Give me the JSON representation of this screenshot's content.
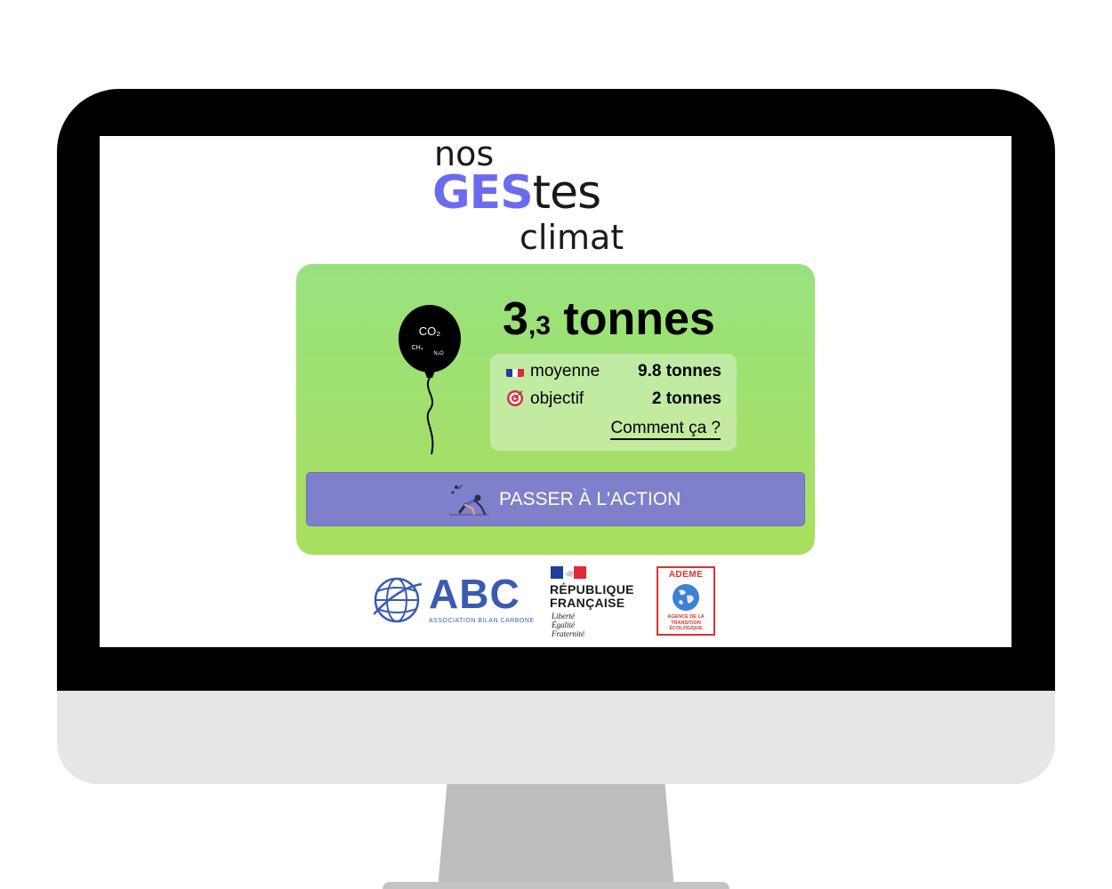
{
  "app": {
    "logo": {
      "word1": "nos",
      "word2_highlight": "GES",
      "word2_rest": "tes",
      "word3": "climat",
      "highlight_color": "#6b6bf0"
    }
  },
  "result_card": {
    "footprint_integer": "3",
    "footprint_decimal": ",3",
    "footprint_unit": "tonnes",
    "balloon_labels": {
      "main": "CO₂",
      "secondary": "CH₄",
      "tertiary": "N₂O"
    },
    "comparison": {
      "average_label": "moyenne",
      "average_value": "9.8 tonnes",
      "target_label": "objectif",
      "target_value": "2 tonnes",
      "explain_link": "Comment ça ?"
    },
    "action_button_label": "PASSER À L'ACTION",
    "card_color": "#98e27e",
    "button_color": "#7f7fcb"
  },
  "partners": {
    "abc": {
      "name": "ABC",
      "subtitle": "ASSOCIATION BILAN CARBONE"
    },
    "republique": {
      "line1": "RÉPUBLIQUE",
      "line2": "FRANÇAISE",
      "motto1": "Liberté",
      "motto2": "Égalité",
      "motto3": "Fraternité"
    },
    "ademe": {
      "name": "ADEME",
      "subtitle": "AGENCE DE LA TRANSITION ÉCOLOGIQUE"
    }
  }
}
